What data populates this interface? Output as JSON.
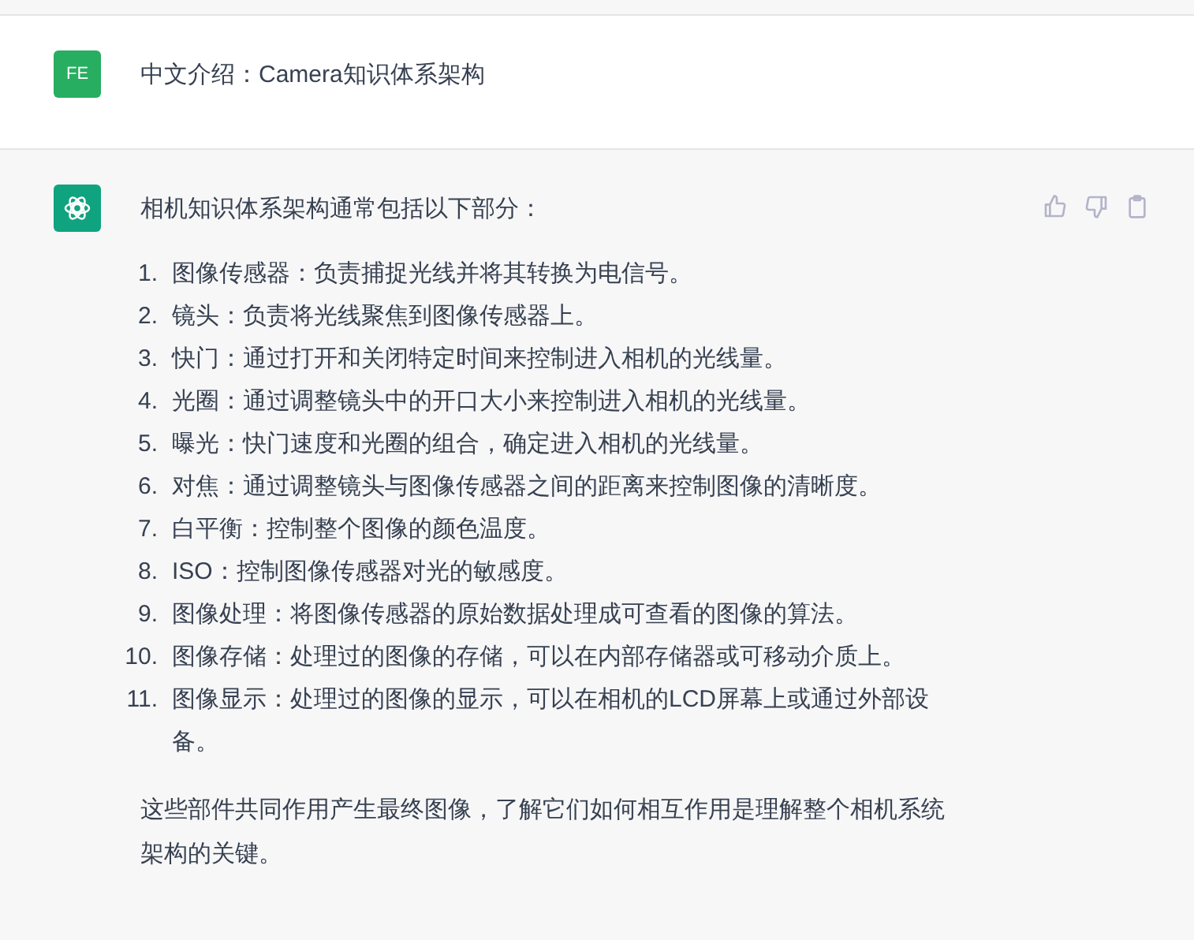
{
  "user_message": {
    "avatar": "FE",
    "text": "中文介绍：Camera知识体系架构"
  },
  "assistant_message": {
    "intro": "相机知识体系架构通常包括以下部分：",
    "items": [
      {
        "number": "1.",
        "text": "图像传感器：负责捕捉光线并将其转换为电信号。"
      },
      {
        "number": "2.",
        "text": "镜头：负责将光线聚焦到图像传感器上。"
      },
      {
        "number": "3.",
        "text": "快门：通过打开和关闭特定时间来控制进入相机的光线量。"
      },
      {
        "number": "4.",
        "text": "光圈：通过调整镜头中的开口大小来控制进入相机的光线量。"
      },
      {
        "number": "5.",
        "text": "曝光：快门速度和光圈的组合，确定进入相机的光线量。"
      },
      {
        "number": "6.",
        "text": "对焦：通过调整镜头与图像传感器之间的距离来控制图像的清晰度。"
      },
      {
        "number": "7.",
        "text": "白平衡：控制整个图像的颜色温度。"
      },
      {
        "number": "8.",
        "text": "ISO：控制图像传感器对光的敏感度。"
      },
      {
        "number": "9.",
        "text": "图像处理：将图像传感器的原始数据处理成可查看的图像的算法。"
      },
      {
        "number": "10.",
        "text": "图像存储：处理过的图像的存储，可以在内部存储器或可移动介质上。"
      },
      {
        "number": "11.",
        "text": "图像显示：处理过的图像的显示，可以在相机的LCD屏幕上或通过外部设备。"
      }
    ],
    "conclusion": "这些部件共同作用产生最终图像，了解它们如何相互作用是理解整个相机系统架构的关键。"
  }
}
